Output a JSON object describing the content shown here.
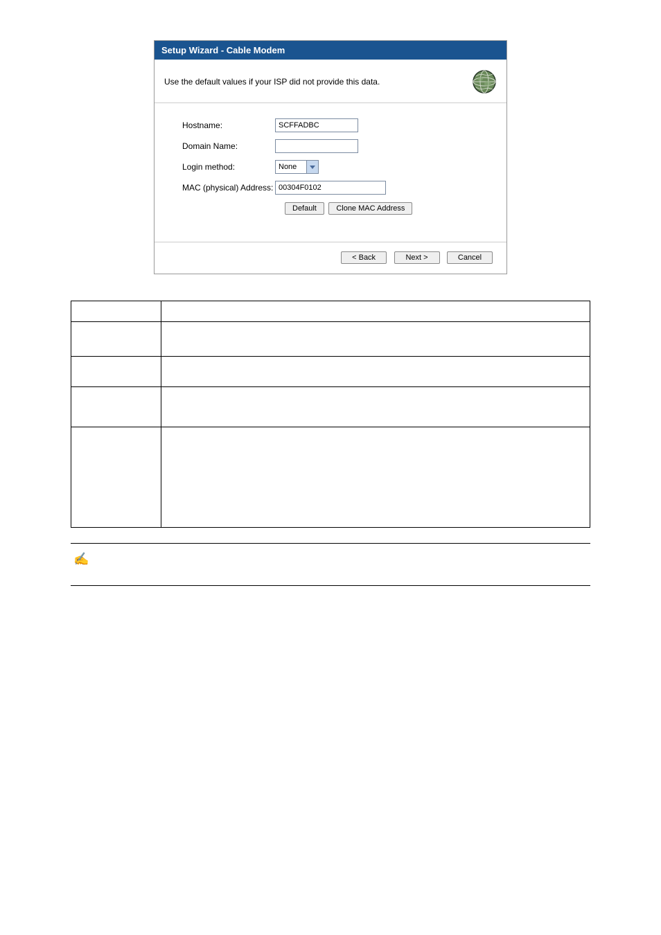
{
  "wizard": {
    "title": "Setup Wizard - Cable Modem",
    "hint": "Use the default values if your ISP did not provide this data.",
    "icon": "globe-icon",
    "fields": {
      "hostname_label": "Hostname:",
      "hostname_value": "SCFFADBC",
      "domain_label": "Domain Name:",
      "domain_value": "",
      "login_label": "Login method:",
      "login_value": "None",
      "mac_label": "MAC (physical) Address:",
      "mac_value": "00304F0102"
    },
    "buttons": {
      "default": "Default",
      "clone": "Clone MAC Address",
      "back": "< Back",
      "next": "Next >",
      "cancel": "Cancel"
    }
  }
}
